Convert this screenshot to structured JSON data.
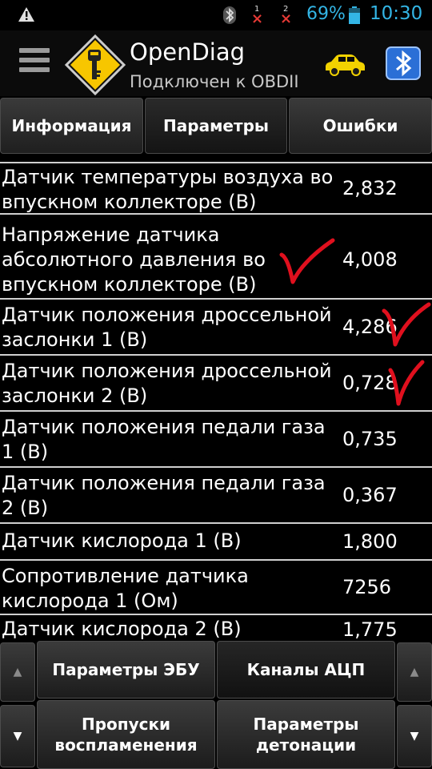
{
  "status_bar": {
    "sim1": "1",
    "sim2": "2",
    "battery": "69%",
    "time": "10:30",
    "icons": [
      "warning-icon",
      "bluetooth-icon",
      "no-signal-sim1-icon",
      "no-signal-sim2-icon",
      "battery-icon"
    ]
  },
  "app": {
    "title": "OpenDiag",
    "subtitle": "Подключен к OBDII"
  },
  "tabs": [
    {
      "label": "Информация"
    },
    {
      "label": "Параметры"
    },
    {
      "label": "Ошибки"
    }
  ],
  "rows": [
    {
      "label": "Датчик температуры воздуха во впускном коллекторе (В)",
      "value": "2,832"
    },
    {
      "label": "Напряжение датчика абсолютного давления во впускном коллекторе (В)",
      "value": "4,008"
    },
    {
      "label": "Датчик положения дроссельной заслонки 1 (В)",
      "value": "4,286"
    },
    {
      "label": "Датчик положения дроссельной заслонки 2 (В)",
      "value": "0,728"
    },
    {
      "label": "Датчик положения педали газа 1 (В)",
      "value": "0,735"
    },
    {
      "label": "Датчик положения педали газа 2 (В)",
      "value": "0,367"
    },
    {
      "label": "Датчик кислорода 1 (В)",
      "value": "1,800"
    },
    {
      "label": "Сопротивление датчика кислорода 1 (Ом)",
      "value": "7256"
    },
    {
      "label": "Датчик кислорода 2 (В)",
      "value": "1,775"
    }
  ],
  "bottom": {
    "btn_ecu_params": "Параметры ЭБУ",
    "btn_adc_channels": "Каналы АЦП",
    "btn_misfires": "Пропуски воспламенения",
    "btn_knock_params": "Параметры детонации",
    "arrow_up": "▲",
    "arrow_down": "▼"
  },
  "colors": {
    "accent": "#33b5e5",
    "logo_yellow": "#f7c600",
    "car_yellow": "#f2d200",
    "annotation_red": "#e0101e"
  }
}
